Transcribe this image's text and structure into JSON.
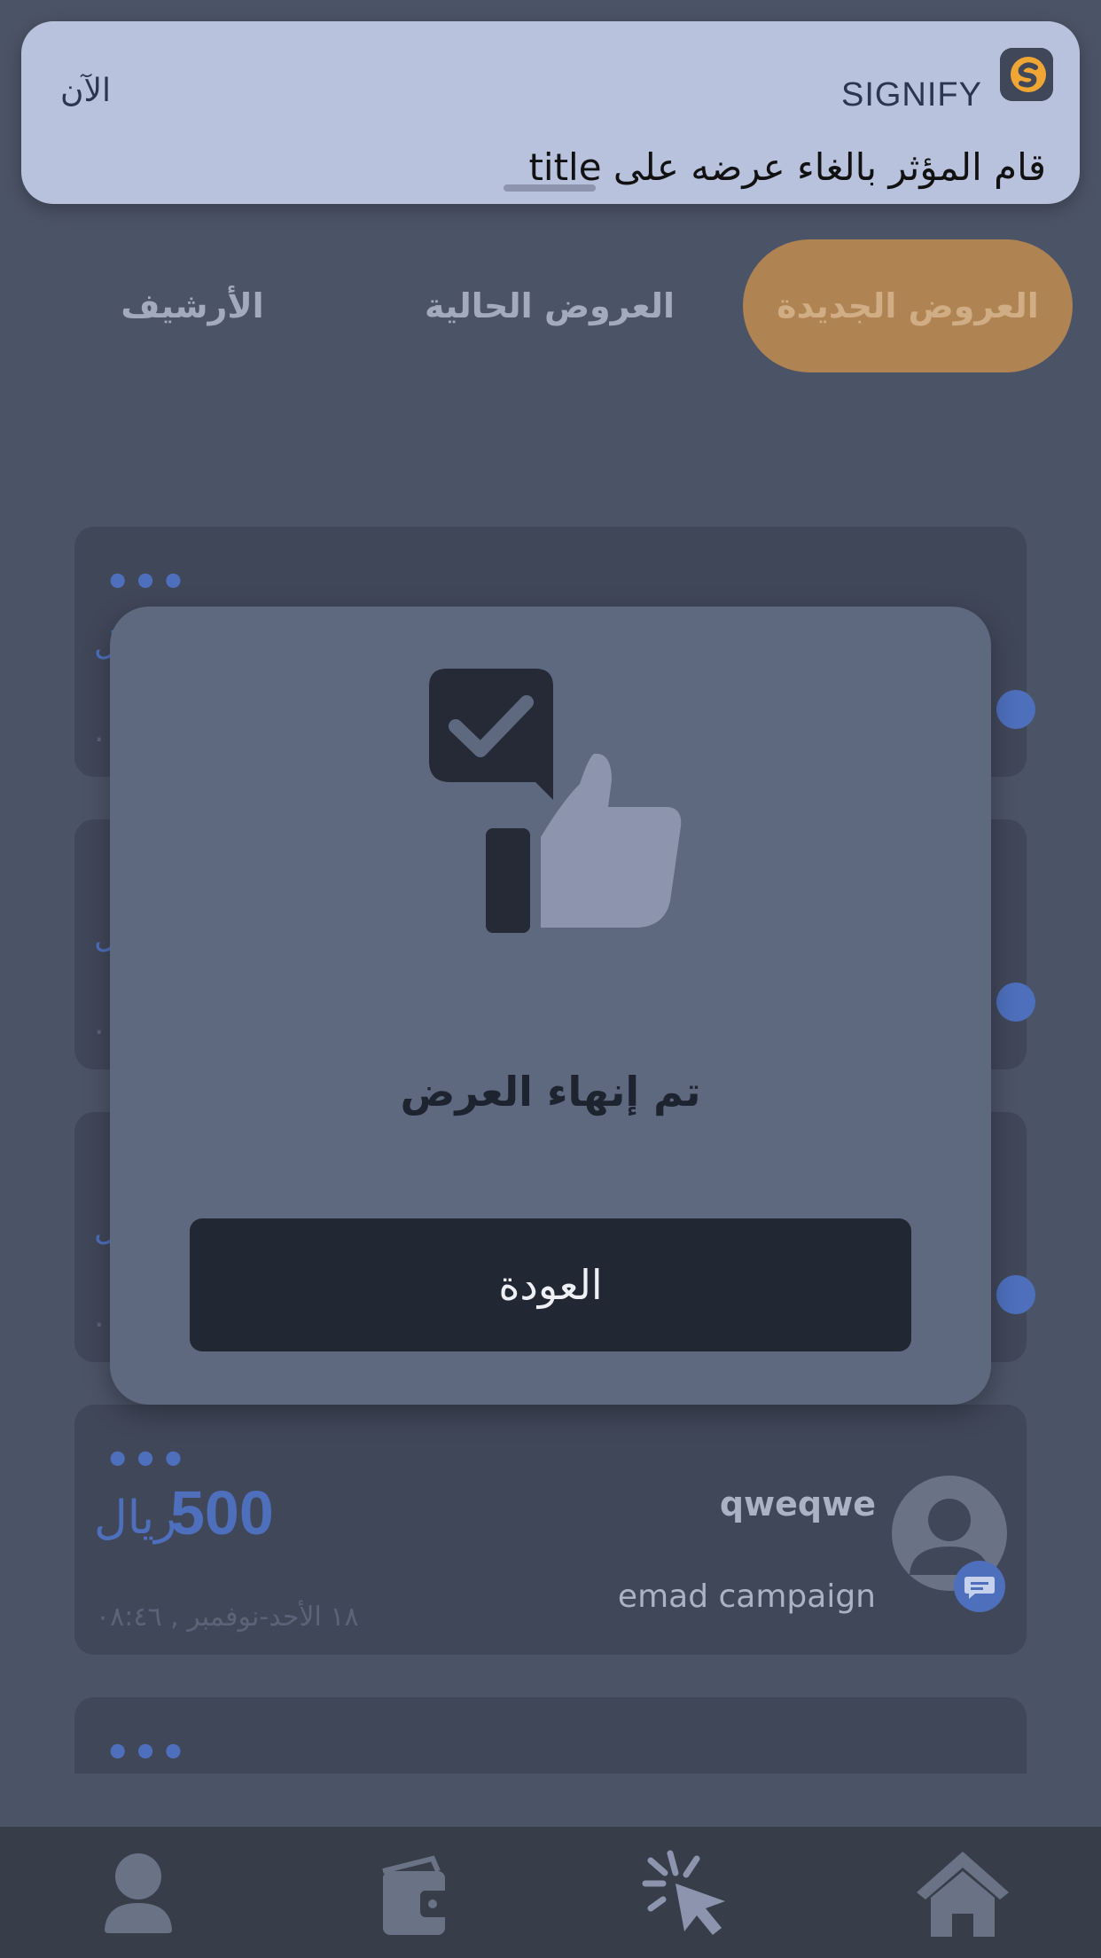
{
  "notification": {
    "app_name": "SIGNIFY",
    "time": "الآن",
    "message": "قام المؤثر بالغاء عرضه على title"
  },
  "tabs": [
    {
      "label": "العروض الجديدة",
      "active": true
    },
    {
      "label": "العروض الحالية",
      "active": false
    },
    {
      "label": "الأرشيف",
      "active": false
    }
  ],
  "colors": {
    "accent": "#b08352",
    "primary_blue": "#4e6fbc",
    "modal_bg": "#5e697f",
    "button_bg": "#222734"
  },
  "cards": {
    "more_symbol": "•••",
    "visible_card": {
      "price_amount": "500",
      "price_currency": "ريال",
      "name": "qweqwe",
      "campaign": "emad campaign",
      "date": "١٨ الأحد-نوفمبر , ٠٨:٤٦"
    },
    "partial_left_char": "ل",
    "partial_date_char": "."
  },
  "modal": {
    "icon": "thumbs-up-check-icon",
    "title": "تم إنهاء العرض",
    "button_label": "العودة"
  },
  "bottom_nav": [
    {
      "icon": "profile-icon"
    },
    {
      "icon": "wallet-icon"
    },
    {
      "icon": "click-cursor-icon"
    },
    {
      "icon": "home-icon"
    }
  ]
}
